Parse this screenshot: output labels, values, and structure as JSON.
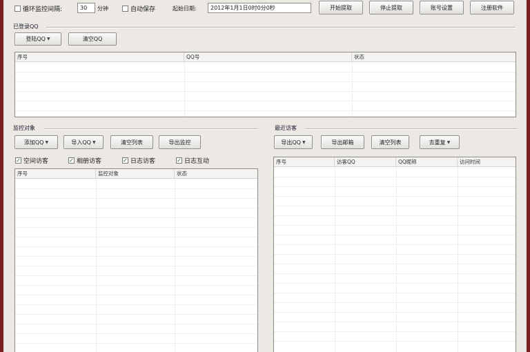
{
  "toolbar": {
    "loop_check": {
      "label": "循环监控间隔:",
      "checked": false
    },
    "interval_value": "30",
    "interval_unit": "分钟",
    "auto_save": {
      "label": "自动保存",
      "checked": false
    },
    "start_date_label": "起始日期:",
    "start_date_value": "2012年1月1日0时0分0秒",
    "buttons": [
      "开始提取",
      "停止提取",
      "账号设置",
      "注册软件"
    ]
  },
  "logged_qq": {
    "label": "已登录QQ",
    "buttons": {
      "login": "登陆QQ",
      "clear": "清空QQ"
    },
    "columns": [
      "序号",
      "QQ号",
      "状态"
    ]
  },
  "monitor": {
    "label": "监控对象",
    "buttons": {
      "add": "添加QQ",
      "import": "导入QQ",
      "clear": "清空列表",
      "export": "导出监控"
    },
    "checks": [
      {
        "label": "空间访客",
        "checked": true
      },
      {
        "label": "相册访客",
        "checked": true
      },
      {
        "label": "日志访客",
        "checked": true
      },
      {
        "label": "日志互动",
        "checked": true
      }
    ],
    "columns": [
      "序号",
      "监控对象",
      "状态"
    ]
  },
  "visitors": {
    "label": "最近访客",
    "buttons": {
      "export": "导出QQ",
      "export_email": "导出邮箱",
      "clear": "清空列表",
      "dedupe": "去重复"
    },
    "columns": [
      "序号",
      "访客QQ",
      "QQ昵称",
      "访问时间"
    ]
  },
  "colors": {
    "window_border": "#7d1d1d",
    "face": "#ece9e4"
  }
}
